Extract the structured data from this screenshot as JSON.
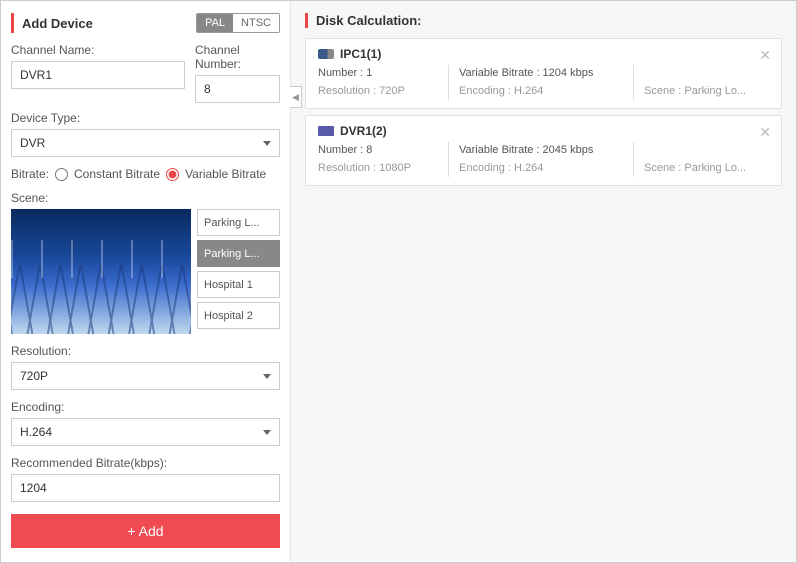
{
  "left": {
    "title": "Add Device",
    "toggle": {
      "pal": "PAL",
      "ntsc": "NTSC",
      "active": "PAL"
    },
    "channelNameLabel": "Channel Name:",
    "channelName": "DVR1",
    "channelNumberLabel": "Channel Number:",
    "channelNumber": "8",
    "deviceTypeLabel": "Device Type:",
    "deviceType": "DVR",
    "bitrateLabel": "Bitrate:",
    "bitrateConstant": "Constant Bitrate",
    "bitrateVariable": "Variable Bitrate",
    "sceneLabel": "Scene:",
    "sceneButtons": [
      "Parking L...",
      "Parking L...",
      "Hospital 1",
      "Hospital 2"
    ],
    "sceneActiveIndex": 1,
    "resolutionLabel": "Resolution:",
    "resolution": "720P",
    "encodingLabel": "Encoding:",
    "encoding": "H.264",
    "recBitrateLabel": "Recommended Bitrate(kbps):",
    "recBitrate": "1204",
    "addButton": "+ Add"
  },
  "right": {
    "title": "Disk Calculation:",
    "devices": [
      {
        "icon": "ipc",
        "name": "IPC1(1)",
        "numberLabel": "Number :",
        "number": "1",
        "bitrateLabel": "Variable Bitrate :",
        "bitrate": "1204 kbps",
        "resolutionLabel": "Resolution :",
        "resolution": "720P",
        "encodingLabel": "Encoding :",
        "encoding": "H.264",
        "sceneLabel": "Scene :",
        "scene": "Parking Lo..."
      },
      {
        "icon": "dvr",
        "name": "DVR1(2)",
        "numberLabel": "Number :",
        "number": "8",
        "bitrateLabel": "Variable Bitrate :",
        "bitrate": "2045 kbps",
        "resolutionLabel": "Resolution :",
        "resolution": "1080P",
        "encodingLabel": "Encoding :",
        "encoding": "H.264",
        "sceneLabel": "Scene :",
        "scene": "Parking Lo..."
      }
    ]
  }
}
